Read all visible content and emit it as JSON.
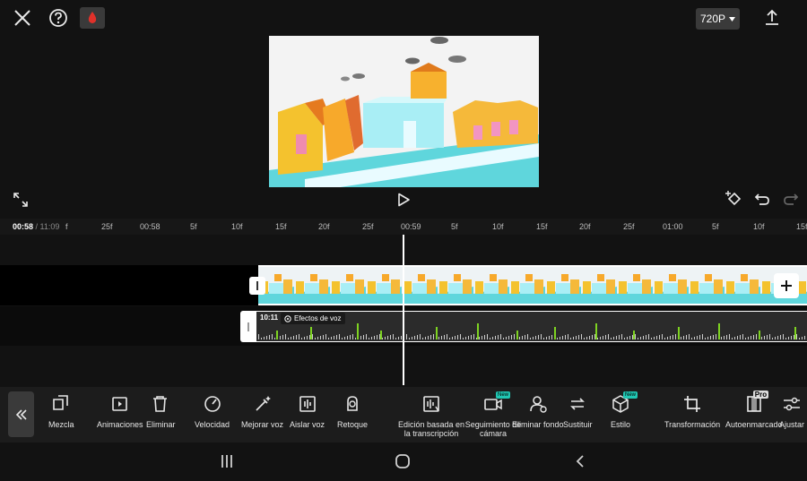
{
  "header": {
    "resolution": "720P"
  },
  "timeline": {
    "current_time": "00:58",
    "total_time": "/ 11:09",
    "ruler_labels": [
      "f",
      "25f",
      "00:58",
      "5f",
      "10f",
      "15f",
      "20f",
      "25f",
      "00:59",
      "5f",
      "10f",
      "15f",
      "20f",
      "25f",
      "01:00",
      "5f",
      "10f",
      "15f"
    ],
    "audio_duration": "10:11",
    "voice_effect_label": "Efectos de voz"
  },
  "toolbar": {
    "tools": [
      {
        "icon": "mix-icon",
        "label": "Mezcla"
      },
      {
        "icon": "animation-icon",
        "label": "Animaciones"
      },
      {
        "icon": "trash-icon",
        "label": "Eliminar"
      },
      {
        "icon": "speed-icon",
        "label": "Velocidad"
      },
      {
        "icon": "enhance-voice-icon",
        "label": "Mejorar voz"
      },
      {
        "icon": "isolate-voice-icon",
        "label": "Aislar voz"
      },
      {
        "icon": "retouch-icon",
        "label": "Retoque"
      },
      {
        "icon": "transcript-edit-icon",
        "label": "Edición basada en la transcripción"
      },
      {
        "icon": "camera-tracking-icon",
        "label": "Seguimiento de cámara",
        "badge": "New"
      },
      {
        "icon": "remove-bg-icon",
        "label": "Eliminar fondo"
      },
      {
        "icon": "replace-icon",
        "label": "Sustituir"
      },
      {
        "icon": "style-icon",
        "label": "Estilo",
        "badge": "New"
      },
      {
        "icon": "crop-icon",
        "label": "Transformación"
      },
      {
        "icon": "auto-reframe-icon",
        "label": "Autoenmarcado",
        "badge": "Pro"
      },
      {
        "icon": "adjust-icon",
        "label": "Ajustar"
      }
    ]
  },
  "colors": {
    "background": "#121212",
    "accent_new": "#1fc6b2",
    "brand_red": "#e0312a",
    "waveform": "#7ed321"
  }
}
